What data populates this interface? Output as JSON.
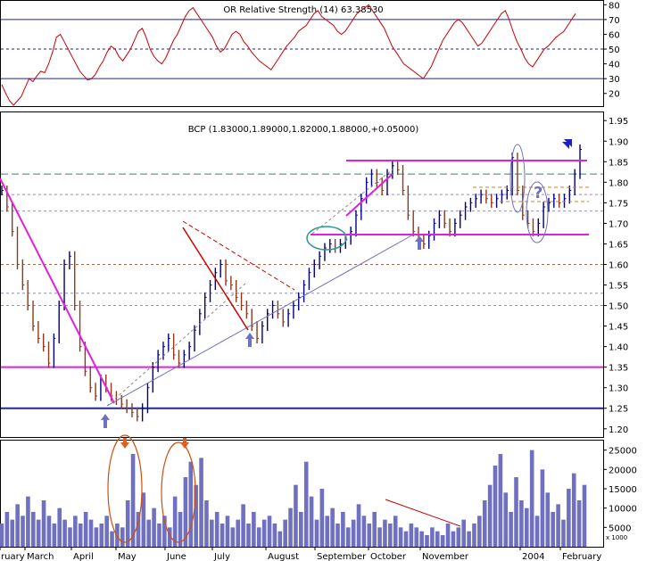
{
  "chart_data": [
    {
      "type": "line",
      "panel": "indicator",
      "title": "OR Relative Strength (14) 63.38530",
      "ylim": [
        12,
        82
      ],
      "y_ticks": [
        20,
        30,
        40,
        50,
        60,
        70,
        80
      ],
      "reference_lines": [
        30,
        50,
        70
      ],
      "color": "#cc0000",
      "series": [
        {
          "values": [
            26,
            20,
            15,
            12,
            15,
            18,
            24,
            30,
            28,
            32,
            35,
            34,
            40,
            48,
            58,
            60,
            55,
            50,
            45,
            40,
            35,
            32,
            29,
            30,
            33,
            38,
            42,
            48,
            52,
            50,
            45,
            42,
            46,
            50,
            56,
            62,
            64,
            58,
            50,
            45,
            42,
            40,
            44,
            50,
            56,
            60,
            66,
            72,
            76,
            78,
            74,
            70,
            66,
            62,
            58,
            52,
            48,
            50,
            55,
            60,
            62,
            60,
            55,
            52,
            48,
            45,
            42,
            40,
            38,
            36,
            40,
            44,
            48,
            52,
            55,
            58,
            62,
            64,
            66,
            70,
            74,
            76,
            72,
            70,
            68,
            66,
            62,
            60,
            62,
            66,
            70,
            74,
            76,
            78,
            80,
            76,
            72,
            68,
            64,
            58,
            52,
            48,
            44,
            40,
            38,
            36,
            34,
            32,
            30,
            34,
            38,
            44,
            50,
            56,
            60,
            64,
            68,
            70,
            68,
            64,
            60,
            56,
            52,
            54,
            58,
            62,
            66,
            70,
            74,
            76,
            70,
            62,
            55,
            50,
            44,
            40,
            38,
            42,
            46,
            50,
            52,
            55,
            58,
            60,
            62,
            66,
            70,
            74
          ]
        }
      ]
    },
    {
      "type": "line",
      "panel": "price",
      "title": "BCP (1.83000,1.89000,1.82000,1.88000,+0.05000)",
      "ylim": [
        1.18,
        1.97
      ],
      "y_ticks": [
        1.2,
        1.25,
        1.3,
        1.35,
        1.4,
        1.45,
        1.5,
        1.55,
        1.6,
        1.65,
        1.7,
        1.75,
        1.8,
        1.85,
        1.9,
        1.95
      ],
      "support_resistance": [
        1.25,
        1.35,
        1.64,
        1.85
      ],
      "dashed_levels": [
        1.82,
        1.77,
        1.73,
        1.6,
        1.53,
        1.5
      ],
      "x_labels": [
        "ruary",
        "March",
        "April",
        "May",
        "June",
        "July",
        "August",
        "September",
        "October",
        "November",
        "2004",
        "February"
      ],
      "series": [
        {
          "name": "BCP",
          "values": [
            1.78,
            1.74,
            1.68,
            1.6,
            1.55,
            1.5,
            1.45,
            1.42,
            1.4,
            1.36,
            1.42,
            1.5,
            1.6,
            1.62,
            1.5,
            1.4,
            1.34,
            1.3,
            1.28,
            1.32,
            1.3,
            1.28,
            1.27,
            1.26,
            1.25,
            1.24,
            1.23,
            1.25,
            1.3,
            1.35,
            1.38,
            1.4,
            1.42,
            1.38,
            1.36,
            1.38,
            1.4,
            1.44,
            1.48,
            1.52,
            1.55,
            1.58,
            1.6,
            1.56,
            1.55,
            1.52,
            1.5,
            1.48,
            1.45,
            1.42,
            1.45,
            1.48,
            1.5,
            1.48,
            1.46,
            1.48,
            1.5,
            1.52,
            1.55,
            1.58,
            1.6,
            1.62,
            1.64,
            1.65,
            1.64,
            1.65,
            1.66,
            1.68,
            1.72,
            1.76,
            1.8,
            1.82,
            1.8,
            1.78,
            1.82,
            1.84,
            1.83,
            1.78,
            1.72,
            1.68,
            1.66,
            1.65,
            1.67,
            1.7,
            1.72,
            1.7,
            1.68,
            1.7,
            1.72,
            1.74,
            1.75,
            1.76,
            1.77,
            1.76,
            1.75,
            1.76,
            1.77,
            1.78,
            1.86,
            1.78,
            1.72,
            1.7,
            1.68,
            1.7,
            1.74,
            1.75,
            1.76,
            1.75,
            1.76,
            1.78,
            1.82,
            1.88
          ]
        }
      ]
    },
    {
      "type": "bar",
      "panel": "volume",
      "unit_label": "x 1000",
      "ylim": [
        0,
        27000
      ],
      "y_ticks": [
        5000,
        10000,
        15000,
        20000,
        25000
      ],
      "color": "#7070c0",
      "values": [
        6000,
        9000,
        7000,
        11000,
        8000,
        13000,
        9000,
        7000,
        12000,
        8000,
        6000,
        10000,
        7000,
        5000,
        8000,
        6000,
        9000,
        7000,
        5000,
        6000,
        8000,
        4000,
        6000,
        5000,
        12000,
        24000,
        9000,
        14000,
        7000,
        10000,
        6000,
        8000,
        5000,
        13000,
        9000,
        18000,
        22000,
        16000,
        23000,
        12000,
        7000,
        9000,
        6000,
        8000,
        5000,
        7000,
        11000,
        6000,
        9000,
        5000,
        7000,
        8000,
        6000,
        4000,
        7000,
        10000,
        16000,
        9000,
        22000,
        13000,
        7000,
        15000,
        8000,
        10000,
        6000,
        9000,
        5000,
        7000,
        11000,
        8000,
        6000,
        9000,
        5000,
        7000,
        6000,
        8000,
        5000,
        4000,
        6000,
        5000,
        4000,
        3000,
        5000,
        4000,
        3000,
        6000,
        4000,
        5000,
        7000,
        4000,
        6000,
        8000,
        12000,
        16000,
        21000,
        24000,
        14000,
        9000,
        18000,
        12000,
        10000,
        25000,
        8000,
        20000,
        14000,
        9000,
        11000,
        7000,
        15000,
        19000,
        12000,
        16000
      ]
    }
  ]
}
